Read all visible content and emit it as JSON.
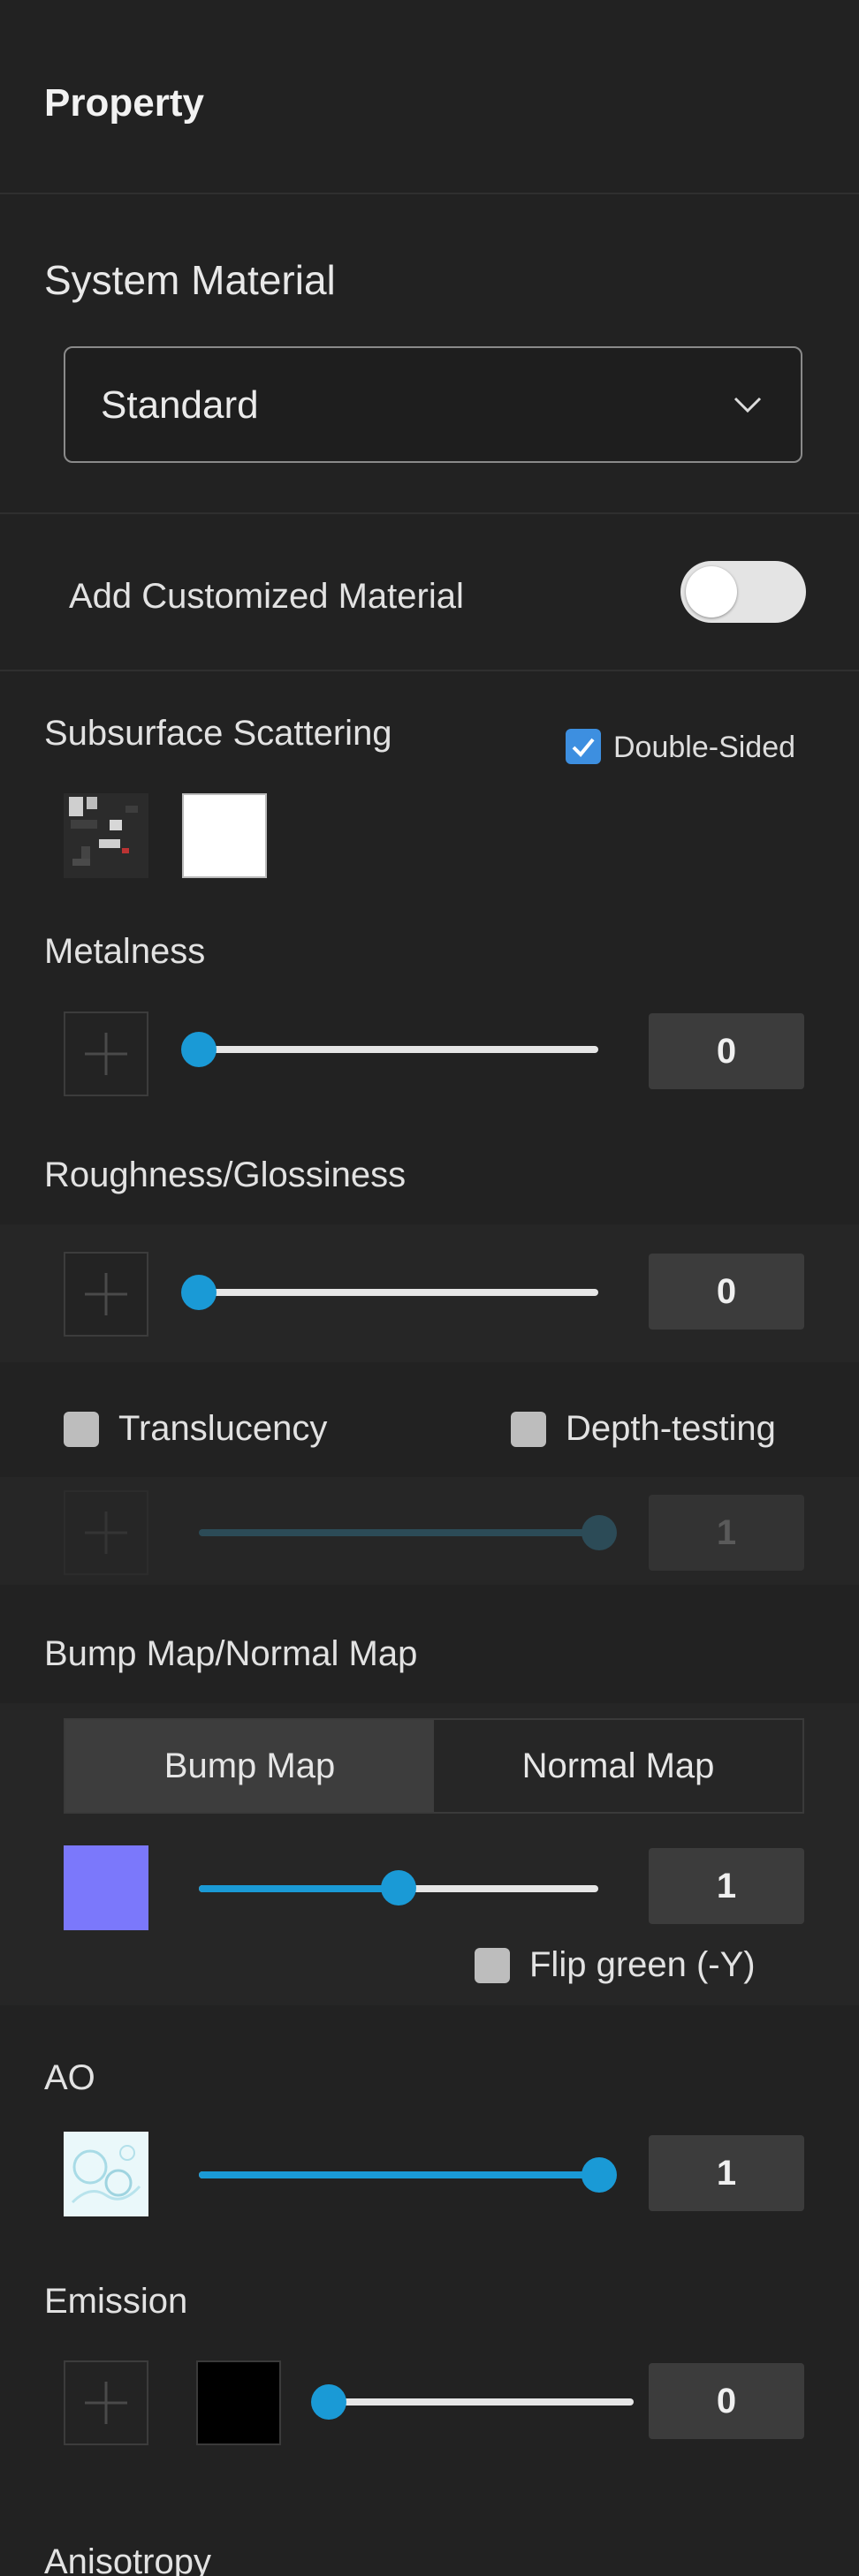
{
  "header": {
    "title": "Property"
  },
  "system_material": {
    "label": "System Material",
    "selected": "Standard"
  },
  "custom_material": {
    "label": "Add Customized Material",
    "enabled": false
  },
  "subsurface": {
    "label": "Subsurface Scattering",
    "double_sided_label": "Double-Sided",
    "double_sided_checked": true,
    "color": "#ffffff"
  },
  "metalness": {
    "label": "Metalness",
    "value": "0",
    "fraction": 0
  },
  "roughness": {
    "label": "Roughness/Glossiness",
    "value": "0",
    "fraction": 0
  },
  "translucency": {
    "label": "Translucency",
    "checked": false,
    "depth_label": "Depth-testing",
    "depth_checked": false,
    "value": "1",
    "fraction": 1
  },
  "bump": {
    "label": "Bump Map/Normal Map",
    "tabs": [
      "Bump Map",
      "Normal Map"
    ],
    "active_tab": "Bump Map",
    "swatch_color": "#7b78fb",
    "value": "1",
    "fraction": 0.5,
    "flip_label": "Flip green (-Y)",
    "flip_checked": false
  },
  "ao": {
    "label": "AO",
    "value": "1",
    "fraction": 1
  },
  "emission": {
    "label": "Emission",
    "color": "#000000",
    "value": "0",
    "fraction": 0
  },
  "anisotropy": {
    "label": "Anisotropy"
  },
  "colors": {
    "accent": "#1a9ad6",
    "panel_bg": "#222222",
    "checkbox_checked": "#3d8fe0"
  }
}
